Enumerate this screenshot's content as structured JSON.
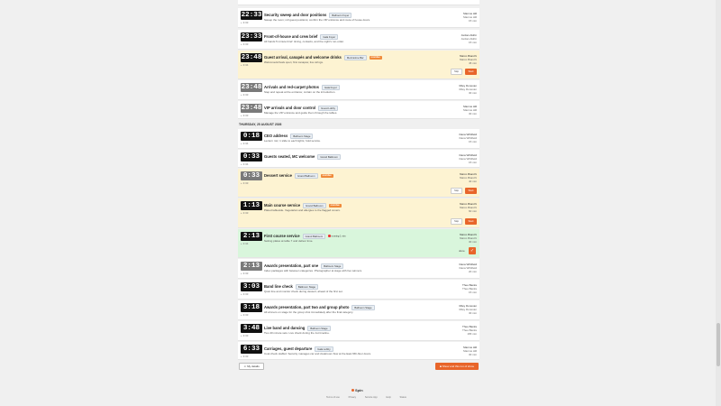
{
  "date_header": "THURSDAY, 25 AUGUST 2026",
  "top_rows": [
    {
      "time": "22:33",
      "delta": "+ 3:33",
      "title": "Security sweep and door positions",
      "tag": "Ballroom Foyer",
      "desc": "Sweep the room; roll guest positions; confirm the VIP entrance and route of house doors.",
      "owner": "Marcus Hill",
      "owner2": "Marcus Hill",
      "duration": "15 min"
    },
    {
      "time": "23:33",
      "delta": "+ 3:33",
      "title": "Front-of-house and crew brief",
      "tag": "Gala Foyer",
      "desc": "All hands 5 minute brief: timing, contacts, and the night's run-order.",
      "owner": "Jordan Aldrin",
      "owner2": "Jordan Aldrin",
      "duration": "15 min"
    },
    {
      "time": "23:48",
      "delta": "+ 3:34",
      "title": "Guest arrival, canapés and welcome drinks",
      "tag": "Mezzanine Bar",
      "badge": "overdue",
      "desc": "Welcome/arrivals open; first canapés; live strings.",
      "owner": "Marco Bianchi",
      "owner2": "Marco Bianchi",
      "duration": "45 min",
      "skip": "Skip",
      "start": "Start"
    },
    {
      "time": "23:48",
      "delta": "+ 3:33",
      "title": "Arrivals and red-carpet photos",
      "tag": "Gala Foyer",
      "desc": "Step and repeat at the entrance; curtain on the introduction.",
      "owner": "Riley Donovan",
      "owner2": "Riley Donovan",
      "duration": "30 min"
    },
    {
      "time": "23:48",
      "delta": "+ 3:33",
      "title": "VIP arrivals and door control",
      "tag": "Guest Lobby",
      "desc": "Manage the VIP entrance and guide them through the tables.",
      "owner": "Marcus Hill",
      "owner2": "Marcus Hill",
      "duration": "30 min"
    }
  ],
  "bottom_rows": [
    {
      "time": "0:18",
      "delta": "+ 3:34",
      "title": "CEO address",
      "tag": "Ballroom Stage",
      "desc": "Lectern mic; 1 slide to each lights; hold service.",
      "owner": "Dana Whitfield",
      "owner2": "Dana Whitfield",
      "duration": "15 min"
    },
    {
      "time": "0:33",
      "delta": "+ 3:34",
      "title": "Guests seated, MC welcome",
      "tag": "Grand Ballroom",
      "desc": "",
      "owner": "Dana Whitfield",
      "owner2": "Dana Whitfield",
      "duration": "15 min"
    },
    {
      "time": "0:33",
      "delta": "+ 3:33",
      "title": "Dessert service",
      "tag": "Grand Ballroom",
      "badge": "overdue",
      "desc": "",
      "owner": "Marco Bianchi",
      "owner2": "Marco Bianchi",
      "duration": "40 min",
      "skip": "Skip",
      "start": "Start"
    },
    {
      "time": "1:13",
      "delta": "+ 3:33",
      "title": "Main course service",
      "tag": "Grand Ballroom",
      "badge": "overdue",
      "desc": "Plated tableside. Vegetarian and allergies to the flagged covers.",
      "owner": "Marco Bianchi",
      "owner2": "Marco Bianchi",
      "duration": "60 min",
      "skip": "Skip",
      "start": "Start"
    },
    {
      "time": "2:13",
      "delta": "+ 3:34",
      "title": "First course service",
      "tag": "Grand Ballroom",
      "running": "running 1 min",
      "desc": "Setting plates at table 7 and deliver time.",
      "owner": "Marco Bianchi",
      "owner2": "Marco Bianchi",
      "duration": "30 min",
      "done": "done"
    },
    {
      "time": "2:13",
      "delta": "+ 3:33",
      "title": "Awards presentation, part one",
      "tag": "Ballroom Stage",
      "desc": "Index packages with between categories. Photographer at stage with live winners.",
      "owner": "Dana Whitfield",
      "owner2": "Dana Whitfield",
      "duration": "20 min"
    },
    {
      "time": "3:03",
      "delta": "+ 3:33",
      "title": "Band line check",
      "tag": "Ballroom Stage",
      "desc": "Quiet line and monitor check during dessert; ahead of the first set.",
      "owner": "Theo Banks",
      "owner2": "Theo Banks",
      "duration": "15 min"
    },
    {
      "time": "3:18",
      "delta": "+ 3:33",
      "title": "Awards presentation, part two and group photo",
      "tag": "Ballroom Stage",
      "desc": "All winners on stage for the group shot immediately after the final category.",
      "owner": "Riley Donovan",
      "owner2": "Riley Donovan",
      "duration": "30 min"
    },
    {
      "time": "3:48",
      "delta": "+ 3:33",
      "title": "Live band and dancing",
      "tag": "Ballroom Stage",
      "desc": "Two 40 minute sets. Live check during the 1st timeline.",
      "owner": "Theo Banks",
      "owner2": "Theo Banks",
      "duration": "165 min"
    },
    {
      "time": "6:33",
      "delta": "+ 3:33",
      "title": "Carriages, guest departure",
      "tag": "Gala Lobby",
      "desc": "Coat check staffed. Security manages car and cloakroom flow at the East fifth-floor doors.",
      "owner": "Marcus Hill",
      "owner2": "Marcus Hill",
      "duration": "30 min"
    }
  ],
  "footer": {
    "my_details": "My details",
    "show_end": "Show end this run of show"
  },
  "brand": "Spin",
  "links": [
    "Terms of use",
    "Privacy",
    "Service App",
    "Help",
    "Status"
  ],
  "colors": {
    "accent": "#e8652a",
    "overdue_row": "#fdf3d2",
    "running_row": "#d9f6dc"
  }
}
